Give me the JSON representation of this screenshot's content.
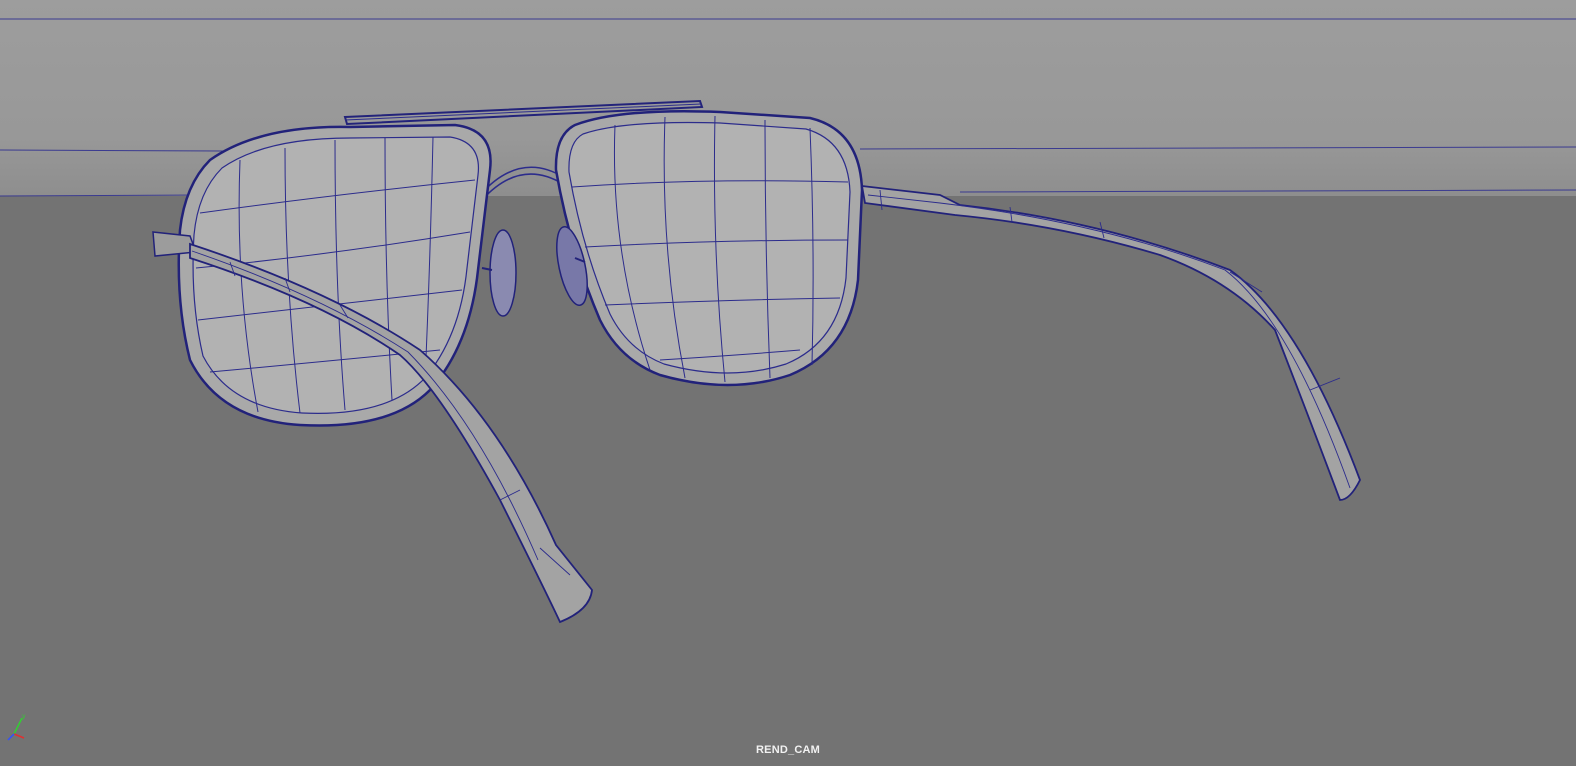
{
  "viewport": {
    "camera_name": "REND_CAM",
    "shading": "wireframe-on-shaded",
    "background_colors": {
      "sky": "#9a9a9a",
      "floor": "#737373"
    },
    "wire_color": "#2c2c8c",
    "surface_color": "#a8a8a8",
    "object": "aviator-sunglasses"
  },
  "axis_gizmo": {
    "icon": "xyz-axis-icon",
    "x_color": "#e03030",
    "y_color": "#30d030",
    "z_color": "#3050ff"
  }
}
